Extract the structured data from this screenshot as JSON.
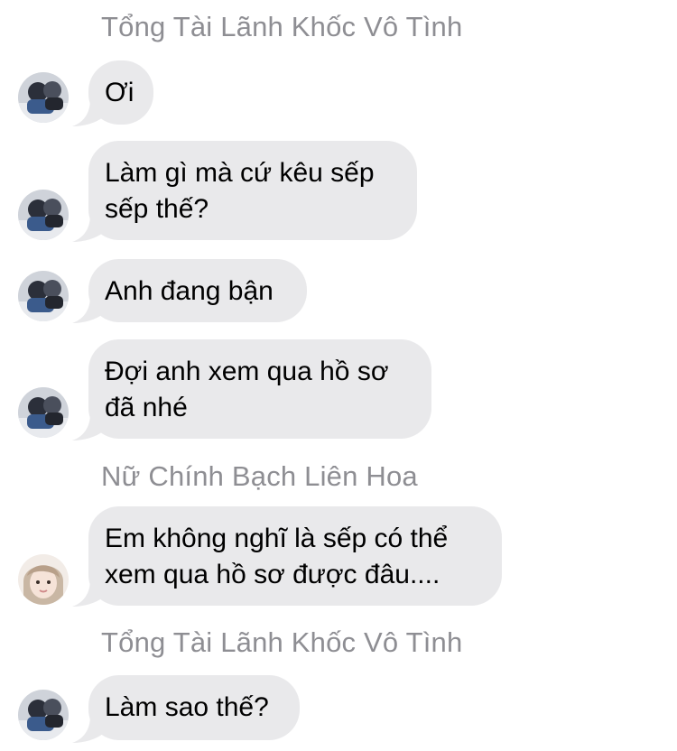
{
  "conversation": {
    "sender_1": "Tổng Tài Lãnh Khốc Vô Tình",
    "msg_1": "Ơi",
    "msg_2_line1": "Làm gì mà cứ kêu sếp",
    "msg_2_line2": "sếp thế?",
    "msg_3": "Anh đang bận",
    "msg_4_line1": "Đợi anh xem qua hồ sơ",
    "msg_4_line2": "đã nhé",
    "sender_2": "Nữ Chính Bạch Liên Hoa",
    "msg_5_line1": "Em không nghĩ là sếp có thể",
    "msg_5_line2": "xem qua hồ sơ được đâu....",
    "sender_3": "Tổng Tài Lãnh Khốc Vô Tình",
    "msg_6": "Làm sao thế?"
  },
  "colors": {
    "bubble": "#e9e9eb",
    "sender_name": "#8e8e93",
    "text": "#000000"
  }
}
